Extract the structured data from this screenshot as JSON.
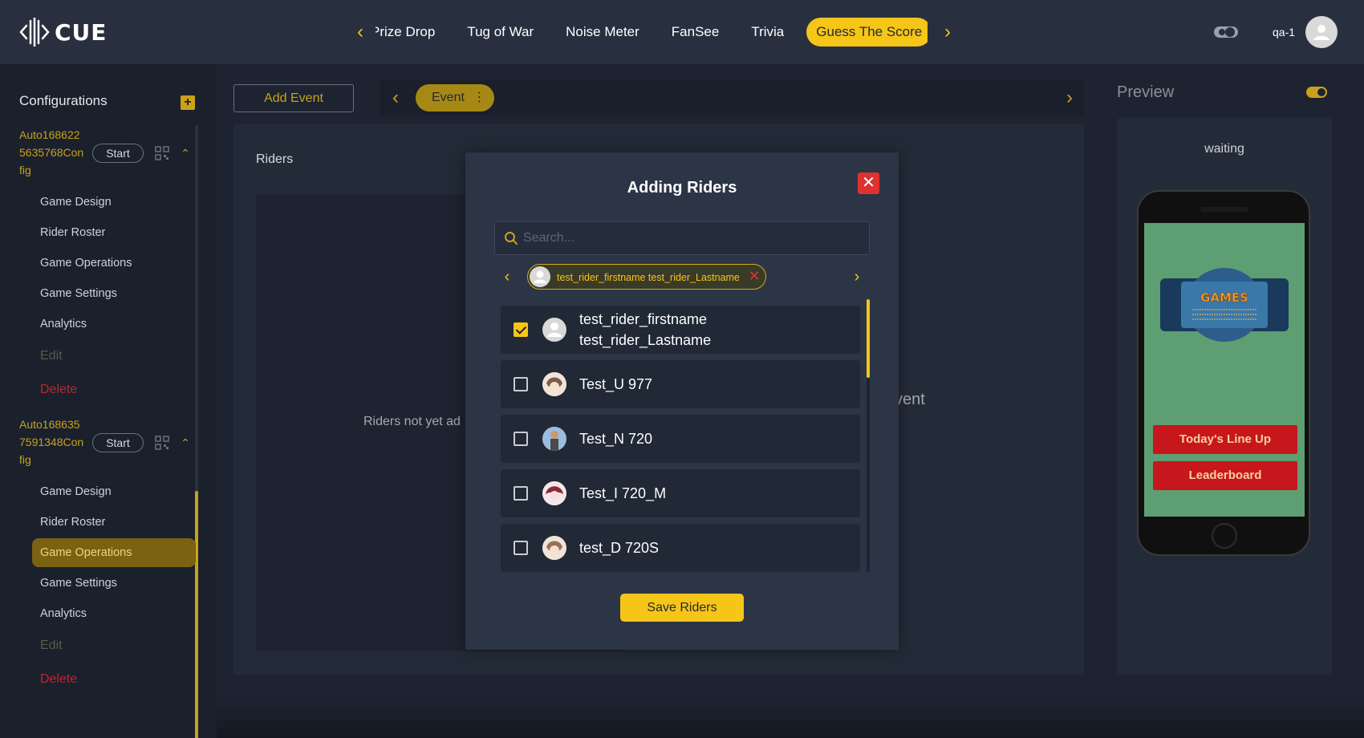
{
  "app": {
    "logo_text": "CUE"
  },
  "header": {
    "tabs": [
      {
        "label": "Prize Drop"
      },
      {
        "label": "Tug of War"
      },
      {
        "label": "Noise Meter"
      },
      {
        "label": "FanSee"
      },
      {
        "label": "Trivia"
      },
      {
        "label": "Guess The Score",
        "active": true
      }
    ],
    "user_name": "qa-1"
  },
  "sidebar": {
    "title": "Configurations",
    "configs": [
      {
        "name": "Auto1686225635768Config",
        "start_label": "Start",
        "items": [
          "Game Design",
          "Rider Roster",
          "Game Operations",
          "Game Settings",
          "Analytics",
          "Edit",
          "Delete"
        ]
      },
      {
        "name": "Auto1686357591348Config",
        "start_label": "Start",
        "items": [
          "Game Design",
          "Rider Roster",
          "Game Operations",
          "Game Settings",
          "Analytics",
          "Edit",
          "Delete"
        ],
        "active_item": "Game Operations"
      }
    ]
  },
  "main": {
    "add_event_label": "Add Event",
    "event_tab_label": "Event",
    "riders_label": "Riders",
    "riders_empty_text": "Riders not yet ad",
    "event_ghost_text": "vent"
  },
  "preview": {
    "title": "Preview",
    "status": "waiting",
    "lineup_label": "Today's Line Up",
    "leaderboard_label": "Leaderboard"
  },
  "modal": {
    "title": "Adding Riders",
    "search_placeholder": "Search...",
    "selected_chip": "test_rider_firstname test_rider_Lastname",
    "riders": [
      {
        "name_line1": "test_rider_firstname",
        "name_line2": "test_rider_Lastname",
        "checked": true
      },
      {
        "name_line1": "Test_U 977",
        "checked": false
      },
      {
        "name_line1": "Test_N 720",
        "checked": false
      },
      {
        "name_line1": "Test_I 720_M",
        "checked": false
      },
      {
        "name_line1": "test_D 720S",
        "checked": false
      }
    ],
    "save_label": "Save Riders"
  },
  "colors": {
    "accent": "#f5c518",
    "danger": "#e03131",
    "background": "#1d2330"
  }
}
